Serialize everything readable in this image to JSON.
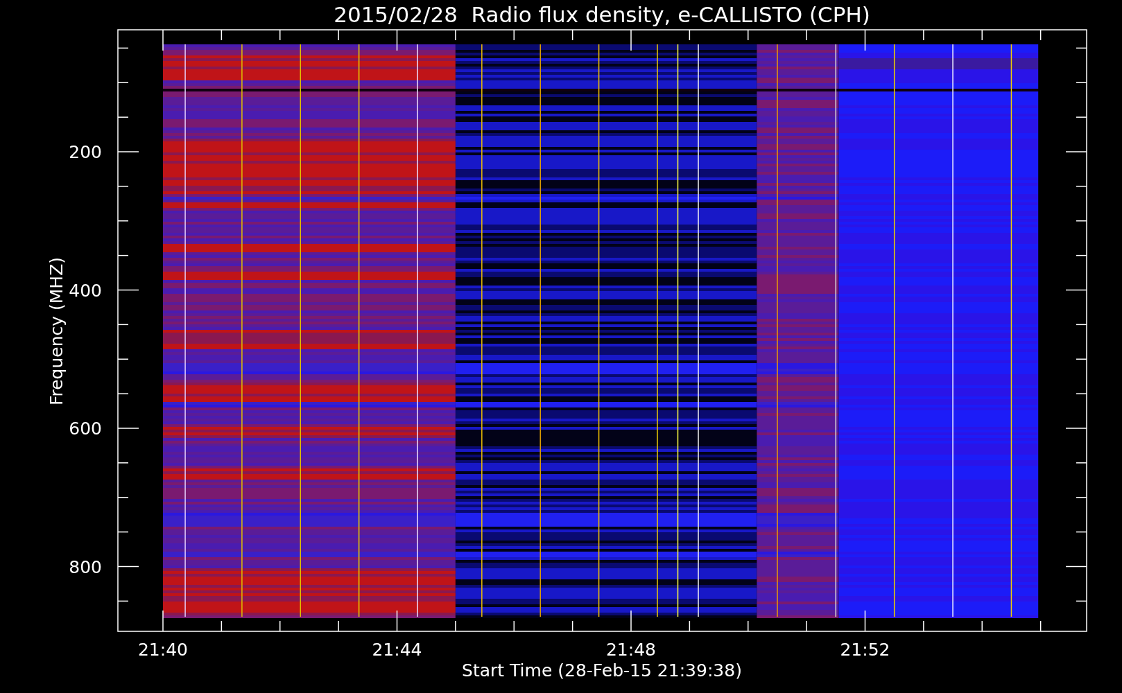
{
  "plot": {
    "title": "2015/02/28  Radio flux density, e-CALLISTO (CPH)",
    "ylabel": "Frequency (MHZ)",
    "xlabel": "Start Time (28-Feb-15 21:39:38)",
    "yticks": [
      "200",
      "400",
      "600",
      "800"
    ],
    "xticks": [
      "21:40",
      "21:44",
      "21:48",
      "21:52"
    ]
  }
}
